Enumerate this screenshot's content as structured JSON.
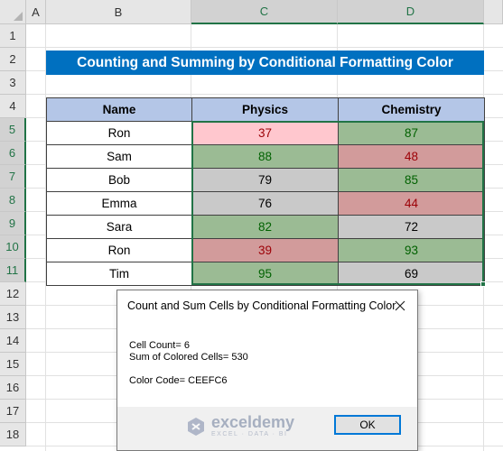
{
  "columns": [
    "A",
    "B",
    "C",
    "D"
  ],
  "rows": [
    "1",
    "2",
    "3",
    "4",
    "5",
    "6",
    "7",
    "8",
    "9",
    "10",
    "11",
    "12",
    "13",
    "14",
    "15",
    "16",
    "17",
    "18"
  ],
  "title": "Counting and Summing by Conditional Formatting Color",
  "table": {
    "headers": [
      "Name",
      "Physics",
      "Chemistry"
    ],
    "rows": [
      {
        "name": "Ron",
        "physics": "37",
        "chemistry": "87"
      },
      {
        "name": "Sam",
        "physics": "88",
        "chemistry": "48"
      },
      {
        "name": "Bob",
        "physics": "79",
        "chemistry": "85"
      },
      {
        "name": "Emma",
        "physics": "76",
        "chemistry": "44"
      },
      {
        "name": "Sara",
        "physics": "82",
        "chemistry": "72"
      },
      {
        "name": "Ron",
        "physics": "39",
        "chemistry": "93"
      },
      {
        "name": "Tim",
        "physics": "95",
        "chemistry": "69"
      }
    ]
  },
  "colors": {
    "pink": {
      "bg": "#ffc7ce",
      "fg": "#9c0006"
    },
    "green": {
      "bg": "#a9d08e",
      "fg": "#006100"
    },
    "grey": {
      "bg": "#c9c9c9",
      "fg": "#000000"
    },
    "red": {
      "bg": "#d29b9b",
      "fg": "#9c0006"
    },
    "green2": {
      "bg": "#9bbb94",
      "fg": "#006100"
    }
  },
  "cell_styles": [
    [
      "pink",
      "green2"
    ],
    [
      "green2",
      "red"
    ],
    [
      "grey",
      "green2"
    ],
    [
      "grey",
      "red"
    ],
    [
      "green2",
      "grey"
    ],
    [
      "red",
      "green2"
    ],
    [
      "green2",
      "grey"
    ]
  ],
  "dialog": {
    "title": "Count and Sum Cells by Conditional Formatting Color",
    "close_icon": "close-icon",
    "line1": "Cell Count= 6",
    "line2": "Sum of Colored Cells= 530",
    "line3": "Color Code= CEEFC6",
    "ok_label": "OK",
    "watermark": {
      "main": "exceldemy",
      "sub": "EXCEL · DATA · BI"
    }
  }
}
